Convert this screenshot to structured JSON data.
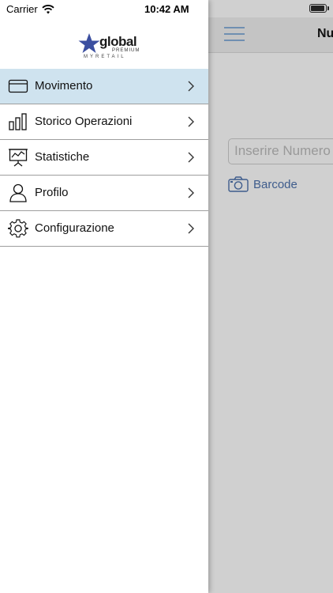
{
  "status_bar": {
    "carrier": "Carrier",
    "time": "10:42 AM"
  },
  "logo": {
    "brand": "global",
    "tier": "PREMIUM",
    "product": "MYRETAIL"
  },
  "menu": {
    "items": [
      {
        "label": "Movimento",
        "icon": "card-icon",
        "active": true
      },
      {
        "label": "Storico Operazioni",
        "icon": "bar-chart-icon",
        "active": false
      },
      {
        "label": "Statistiche",
        "icon": "presentation-chart-icon",
        "active": false
      },
      {
        "label": "Profilo",
        "icon": "user-icon",
        "active": false
      },
      {
        "label": "Configurazione",
        "icon": "gear-icon",
        "active": false
      }
    ]
  },
  "behind": {
    "title": "Nu",
    "search_placeholder": "Inserire Numero",
    "barcode_label": "Barcode"
  },
  "colors": {
    "active_row": "#cfe3ef",
    "accent": "#3e5c8c",
    "hamburger": "#6f8fb1"
  }
}
